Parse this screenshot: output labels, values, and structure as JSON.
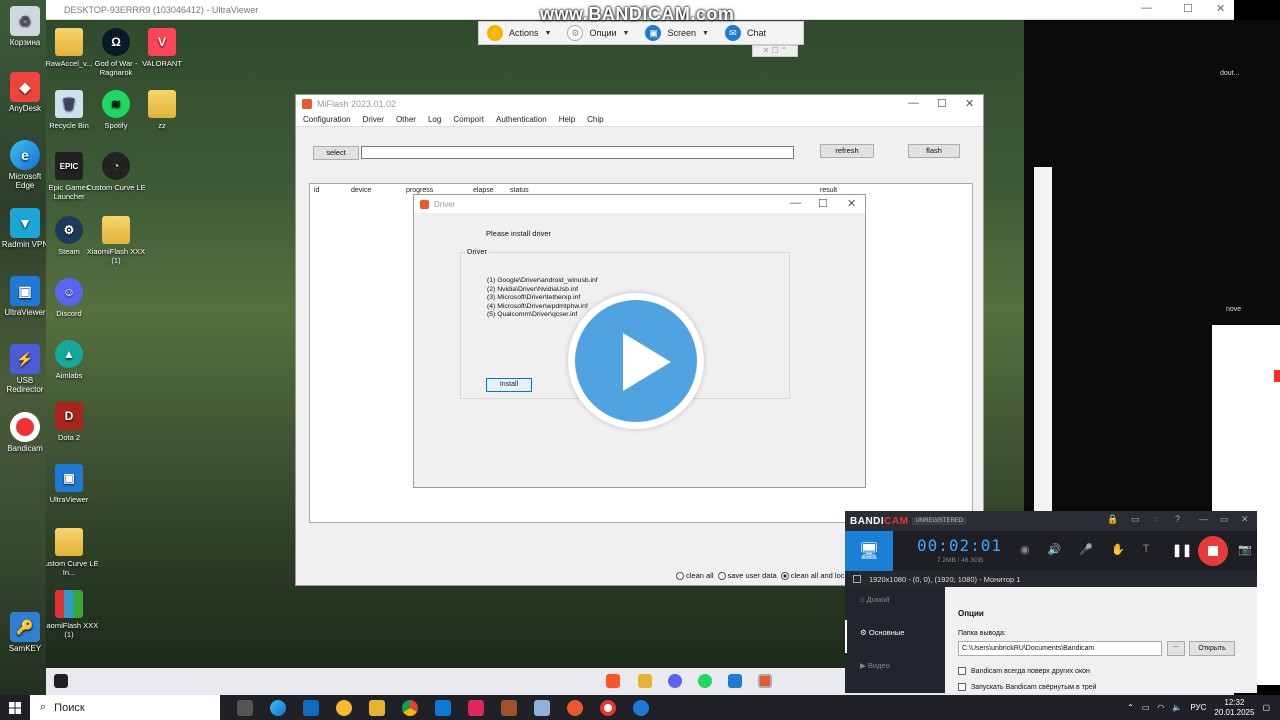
{
  "watermark": "www.BANDICAM.com",
  "left_desktop": {
    "icons": [
      "Корзина",
      "AnyDesk",
      "Microsoft Edge",
      "Radmin VPN",
      "UltraViewer",
      "USB Redirector",
      "Bandicam",
      "SamKEY"
    ]
  },
  "remote_window": {
    "title": "DESKTOP-93ERRR9 (103046412) - UltraViewer",
    "toolbar": {
      "actions": "Actions",
      "options": "Опции",
      "screen": "Screen",
      "chat": "Chat"
    },
    "desktop_icons": [
      {
        "label": "RawAccel_v..."
      },
      {
        "label": "God of War - Ragnarok"
      },
      {
        "label": "VALORANT"
      },
      {
        "label": "Recycle Bin"
      },
      {
        "label": "Spotify"
      },
      {
        "label": "zz"
      },
      {
        "label": "Epic Games Launcher"
      },
      {
        "label": "Custom Curve LE"
      },
      {
        "label": "Steam"
      },
      {
        "label": "XiaomiFlash XXX (1)"
      },
      {
        "label": "Discord"
      },
      {
        "label": "Aimlabs"
      },
      {
        "label": "Dota 2"
      },
      {
        "label": "UltraViewer"
      },
      {
        "label": "Custom Curve LE In..."
      },
      {
        "label": "XiaomiFlash XXX (1)"
      }
    ]
  },
  "miflash": {
    "title": "MiFlash 2023.01.02",
    "menu": [
      "Configuration",
      "Driver",
      "Other",
      "Log",
      "Comport",
      "Authentication",
      "Help",
      "Chip"
    ],
    "select_label": "select",
    "refresh_label": "refresh",
    "flash_label": "flash",
    "columns": [
      "id",
      "device",
      "progress",
      "elapse",
      "status",
      "result"
    ],
    "options": {
      "clean_all": "clean all",
      "save_user_data": "save user data",
      "clean_all_lock": "clean all and loc"
    }
  },
  "driver_dialog": {
    "title": "Driver",
    "message": "Please install driver",
    "group_label": "Driver",
    "drivers": [
      "(1) Google\\Driver\\android_winusb.inf",
      "(2) Nvidia\\Driver\\NvidiaUsb.inf",
      "(3) Microsoft\\Driver\\tetherxp.inf",
      "(4) Microsoft\\Driver\\wpdmtphw.inf",
      "(5) Qualcomm\\Driver\\qcser.inf"
    ],
    "install_label": "Install"
  },
  "right_side": {
    "snippet_1": "dout...",
    "snippet_2": "nove"
  },
  "bandicam": {
    "logo_a": "BANDI",
    "logo_b": "CAM",
    "unregistered": "UNREGISTERED",
    "time": "00:02:01",
    "size": "7.2MB / 46.3GB",
    "resolution": "1920x1080 - (0, 0), (1920, 1080) - Монитор 1",
    "nav": [
      "Домой",
      "Основные",
      "Видео"
    ],
    "section_title": "Опции",
    "output_label": "Папка вывода:",
    "output_path": "C:\\Users\\unbrickRU\\Documents\\Bandicam",
    "browse_label": "...",
    "open_label": "Открыть",
    "checkbox_1": "Bandicam всегда поверх других окон",
    "checkbox_2": "Запускать Bandicam свёрнутым в трей"
  },
  "local_taskbar": {
    "search_placeholder": "Поиск",
    "lang": "РУС",
    "time": "12:32",
    "date": "20.01.2025"
  },
  "colors": {
    "play_button": "#4ea3e0",
    "bandicam_accent": "#1a7fd6",
    "bandicam_stop": "#e93a3a"
  }
}
